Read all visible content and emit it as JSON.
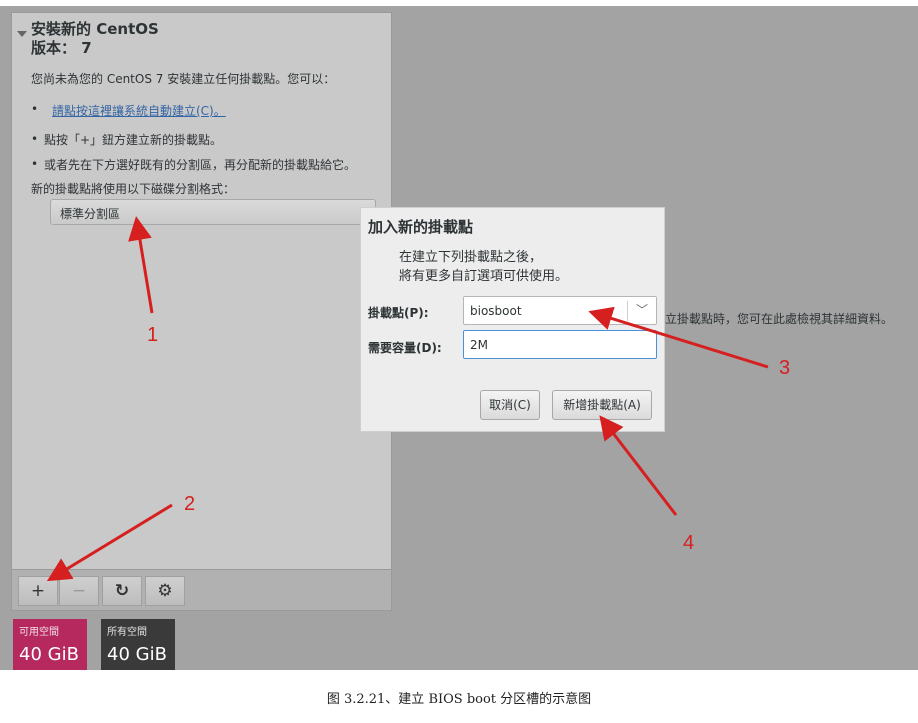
{
  "left": {
    "title": "安裝新的 CentOS",
    "version": "版本： 7",
    "intro": "您尚未為您的 CentOS 7 安裝建立任何掛載點。您可以：",
    "auto_link": "請點按這裡讓系統自動建立(C)。",
    "bullet2": "點按「+」鈕方建立新的掛載點。",
    "bullet3": "或者先在下方選好既有的分割區，再分配新的掛載點給它。",
    "scheme_label": "新的掛載點將使用以下磁碟分割格式：",
    "scheme_value": "標準分割區"
  },
  "toolbar": {
    "add": "+",
    "remove": "−",
    "refresh": "↻",
    "config": "⚙"
  },
  "space": {
    "available_label": "可用空間",
    "available_value": "40 GiB",
    "total_label": "所有空間",
    "total_value": "40 GiB"
  },
  "dialog": {
    "title": "加入新的掛載點",
    "desc1": "在建立下列掛載點之後，",
    "desc2": "將有更多自訂選項可供使用。",
    "mount_label": "掛載點(P):",
    "mount_value": "biosboot",
    "size_label": "需要容量(D):",
    "size_value": "2M",
    "cancel": "取消(C)",
    "add": "新增掛載點(A)"
  },
  "right_hint": "立掛載點時，您可在此處檢視其詳細資料。",
  "callouts": [
    "1",
    "2",
    "3",
    "4"
  ],
  "caption": "图 3.2.21、建立 BIOS boot 分区槽的示意图",
  "colors": {
    "available": "#b5295f",
    "total": "#3a3a3a",
    "arrow": "#d62020",
    "link": "#3465a4"
  },
  "icons": {
    "expander": "triangle-down-icon",
    "combo": "chevron-down-icon"
  }
}
